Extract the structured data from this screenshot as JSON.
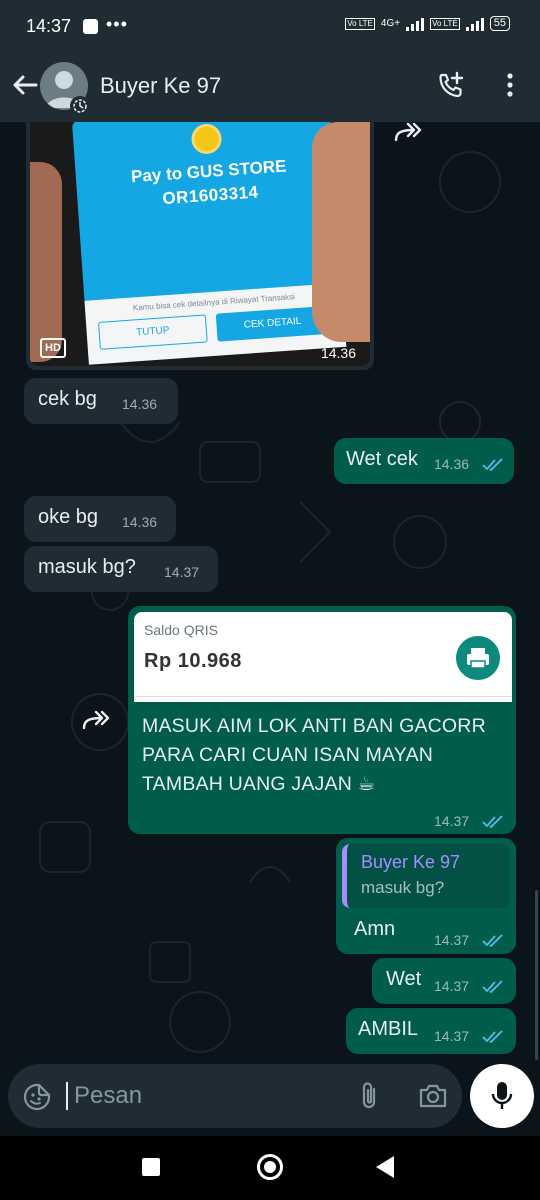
{
  "status": {
    "time": "14:37",
    "net1": "Vo LTE",
    "net2": "4G+",
    "net3": "Vo LTE",
    "battery": "55"
  },
  "header": {
    "contact_name": "Buyer Ke 97"
  },
  "image_message": {
    "screen_title": "Pay to GUS STORE",
    "screen_id": "OR1603314",
    "screen_note": "Kamu bisa cek detailnya di Riwayat Transaksi",
    "btn_close": "TUTUP",
    "btn_detail": "CEK DETAIL",
    "hd_label": "HD",
    "time": "14.36"
  },
  "messages": [
    {
      "text": "cek bg",
      "time": "14.36",
      "direction": "in"
    },
    {
      "text": "Wet cek",
      "time": "14.36",
      "direction": "out"
    },
    {
      "text": "oke bg",
      "time": "14.36",
      "direction": "in"
    },
    {
      "text": "masuk bg?",
      "time": "14.37",
      "direction": "in"
    }
  ],
  "forwarded": {
    "card_label": "Saldo QRIS",
    "card_amount": "Rp 10.968",
    "line1": "MASUK AIM LOK ANTI BAN GACORR",
    "line2": "PARA CARI CUAN ISAN MAYAN",
    "line3": "TAMBAH UANG JAJAN ☕",
    "time": "14.37"
  },
  "reply": {
    "quote_name": "Buyer Ke 97",
    "quote_text": "masuk bg?",
    "text": "Amn",
    "time": "14.37"
  },
  "tail_messages": [
    {
      "text": "Wet",
      "time": "14.37"
    },
    {
      "text": "AMBIL",
      "time": "14.37"
    }
  ],
  "input": {
    "placeholder": "Pesan"
  },
  "colors": {
    "incoming": "#202c33",
    "outgoing": "#005c4b",
    "header": "#1f2c34",
    "read_ticks": "#53bdeb"
  }
}
